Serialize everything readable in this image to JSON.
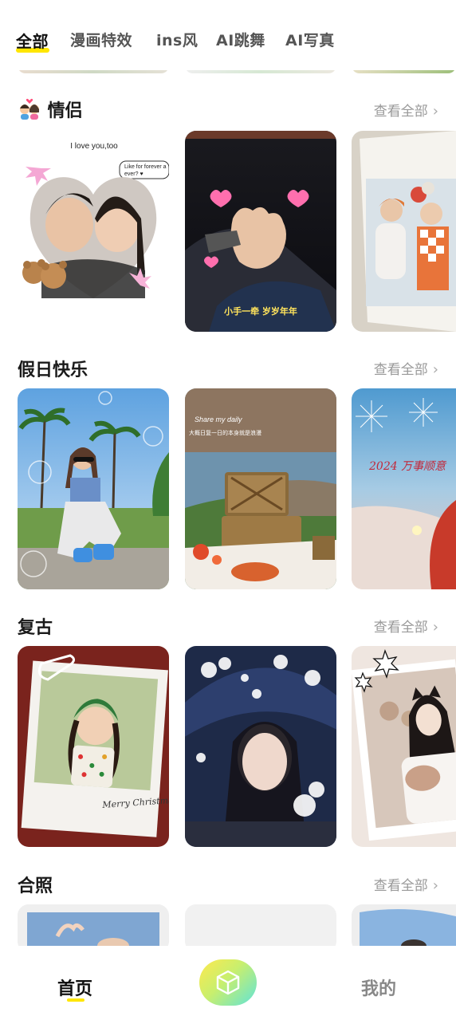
{
  "tabs": [
    {
      "label": "全部",
      "active": true
    },
    {
      "label": "漫画特效",
      "active": false
    },
    {
      "label": "ins风",
      "active": false
    },
    {
      "label": "AI跳舞",
      "active": false
    },
    {
      "label": "AI写真",
      "active": false
    }
  ],
  "sections": [
    {
      "title": "情侣",
      "title_icon": "couple-emoji-icon",
      "see_all": "查看全部",
      "cards": [
        {
          "name": "couple-heart-collage",
          "caption_top": "I love you,too",
          "bubble": "Like for forever and ever?"
        },
        {
          "name": "couple-holding-hands",
          "caption": "小手一牵 岁岁年年"
        },
        {
          "name": "couple-polaroid"
        }
      ]
    },
    {
      "title": "假日快乐",
      "see_all": "查看全部",
      "cards": [
        {
          "name": "holiday-beach-girl"
        },
        {
          "name": "holiday-picnic",
          "caption_top": "Share my daily",
          "caption_sub": "大概日复一日的本身就是浪漫"
        },
        {
          "name": "holiday-fireworks",
          "caption": "2024 万事顺意"
        }
      ]
    },
    {
      "title": "复古",
      "see_all": "查看全部",
      "cards": [
        {
          "name": "retro-christmas-polaroid",
          "caption": "Merry Christmas"
        },
        {
          "name": "retro-blue-hat-girl"
        },
        {
          "name": "retro-bear-girl"
        }
      ]
    },
    {
      "title": "合照",
      "see_all": "查看全部",
      "cards": [
        {
          "name": "group-photo-1"
        },
        {
          "name": "group-photo-2"
        },
        {
          "name": "group-photo-3"
        }
      ]
    }
  ],
  "bottom_nav": {
    "home": "首页",
    "center_icon": "cube-icon",
    "mine": "我的"
  },
  "colors": {
    "accent": "#ffe600",
    "muted_text": "#999999"
  }
}
